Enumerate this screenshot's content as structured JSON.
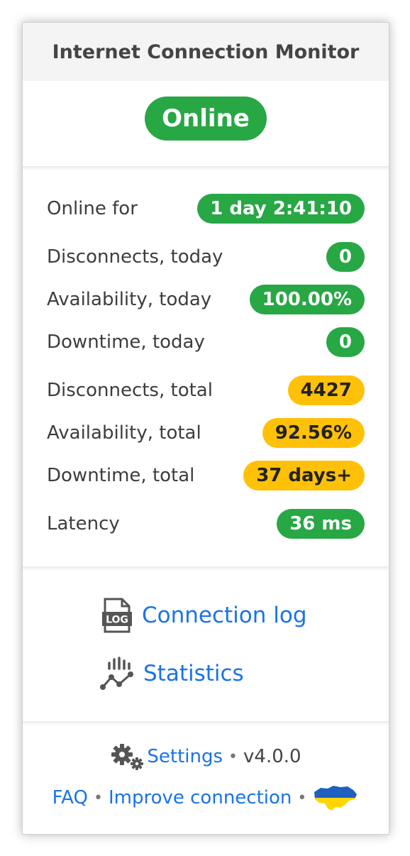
{
  "header": {
    "title": "Internet Connection Monitor"
  },
  "status": {
    "label": "Online",
    "color": "#28a745"
  },
  "stats": [
    {
      "label": "Online for",
      "value": "1 day 2:41:10",
      "level": "green"
    },
    {
      "label": "Disconnects, today",
      "value": "0",
      "level": "green"
    },
    {
      "label": "Availability, today",
      "value": "100.00%",
      "level": "green"
    },
    {
      "label": "Downtime, today",
      "value": "0",
      "level": "green"
    },
    {
      "label": "Disconnects, total",
      "value": "4427",
      "level": "yellow"
    },
    {
      "label": "Availability, total",
      "value": "92.56%",
      "level": "yellow"
    },
    {
      "label": "Downtime, total",
      "value": "37 days+",
      "level": "yellow"
    },
    {
      "label": "Latency",
      "value": "36 ms",
      "level": "green"
    }
  ],
  "links": {
    "connection_log": {
      "label": "Connection log",
      "icon": "log-file-icon",
      "icon_text": "LOG"
    },
    "statistics": {
      "label": "Statistics",
      "icon": "statistics-chart-icon"
    }
  },
  "footer": {
    "settings_label": "Settings",
    "settings_icon": "gears-icon",
    "separator": "•",
    "version": "v4.0.0",
    "faq_label": "FAQ",
    "improve_label": "Improve connection",
    "flag_icon": "ukraine-flag-icon"
  },
  "colors": {
    "green": "#28a745",
    "yellow": "#ffc107",
    "link": "#1a73e8"
  }
}
